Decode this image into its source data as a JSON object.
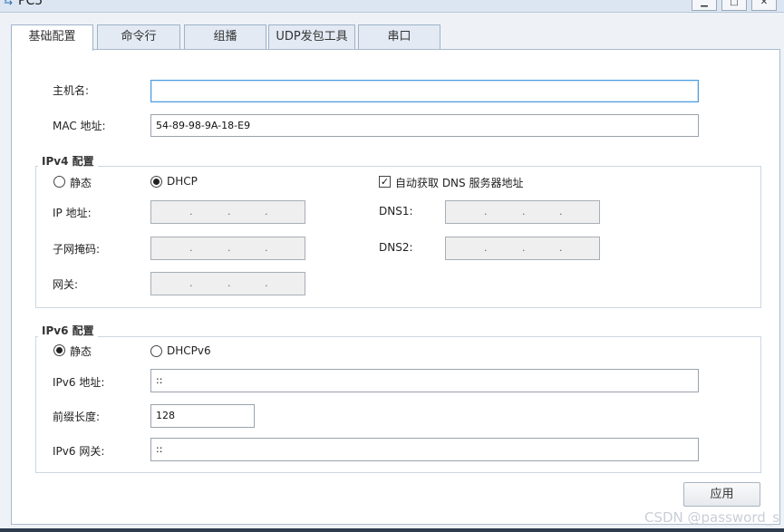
{
  "window": {
    "title": "PC5",
    "minimize": "▁",
    "maximize": "□",
    "close": "✕"
  },
  "tabs": [
    "基础配置",
    "命令行",
    "组播",
    "UDP发包工具",
    "串口"
  ],
  "basic": {
    "hostname_label": "主机名:",
    "hostname_value": "",
    "mac_label": "MAC 地址:",
    "mac_value": "54-89-98-9A-18-E9"
  },
  "ipv4": {
    "legend": "IPv4 配置",
    "static_label": "静态",
    "dhcp_label": "DHCP",
    "mode_selected": "DHCP",
    "dns_auto_label": "自动获取 DNS 服务器地址",
    "dns_auto_checked": true,
    "ip_label": "IP 地址:",
    "mask_label": "子网掩码:",
    "gateway_label": "网关:",
    "dns1_label": "DNS1:",
    "dns2_label": "DNS2:",
    "dot": "."
  },
  "ipv6": {
    "legend": "IPv6 配置",
    "static_label": "静态",
    "dhcpv6_label": "DHCPv6",
    "mode_selected": "静态",
    "address_label": "IPv6 地址:",
    "address_value": "::",
    "prefix_label": "前缀长度:",
    "prefix_value": "128",
    "gateway_label": "IPv6 网关:",
    "gateway_value": "::"
  },
  "apply_label": "应用",
  "watermark": "CSDN @password_s",
  "icons": {
    "app": "network-pc-icon",
    "check": "check-icon"
  }
}
